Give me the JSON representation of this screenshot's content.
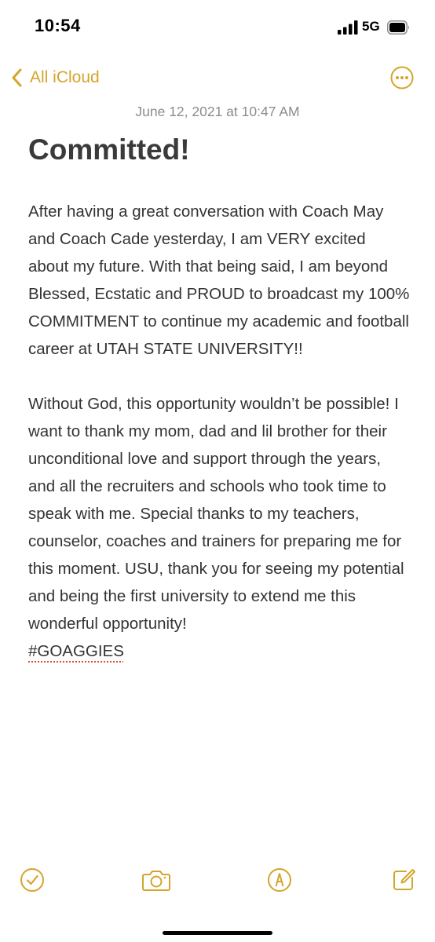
{
  "status_bar": {
    "time": "10:54",
    "network": "5G",
    "icons": [
      "signal-bars-icon",
      "battery-icon"
    ]
  },
  "nav": {
    "back_label": "All iCloud",
    "back_icon": "chevron-left-icon",
    "more_icon": "ellipsis-circle-icon"
  },
  "note": {
    "date": "June 12, 2021 at 10:47 AM",
    "title": "Committed!",
    "paragraph1": "After having a great conversation with Coach May and Coach Cade yesterday, I am VERY excited about my future. With that being said, I am beyond Blessed, Ecstatic and PROUD to broadcast my 100% COMMITMENT to continue my academic and football career at UTAH STATE UNIVERSITY!!",
    "paragraph2": "Without God, this opportunity wouldn’t be possible! I want to thank my mom, dad and lil brother for their unconditional love and support through the years, and all the recruiters and schools who took time to speak with me. Special thanks to my teachers, counselor, coaches and trainers for preparing me for this moment. USU, thank you for seeing my potential and being the first university to extend me this wonderful opportunity!",
    "hashtag": "#GOAGGIES"
  },
  "toolbar": {
    "icons": [
      "checklist-icon",
      "camera-icon",
      "markup-pen-icon",
      "compose-icon"
    ]
  },
  "colors": {
    "accent": "#d4a52b",
    "date_text": "#8c8c90",
    "title_text": "#3a3a3a",
    "body_text": "#333333",
    "spellcheck_underline": "#e0473b"
  }
}
